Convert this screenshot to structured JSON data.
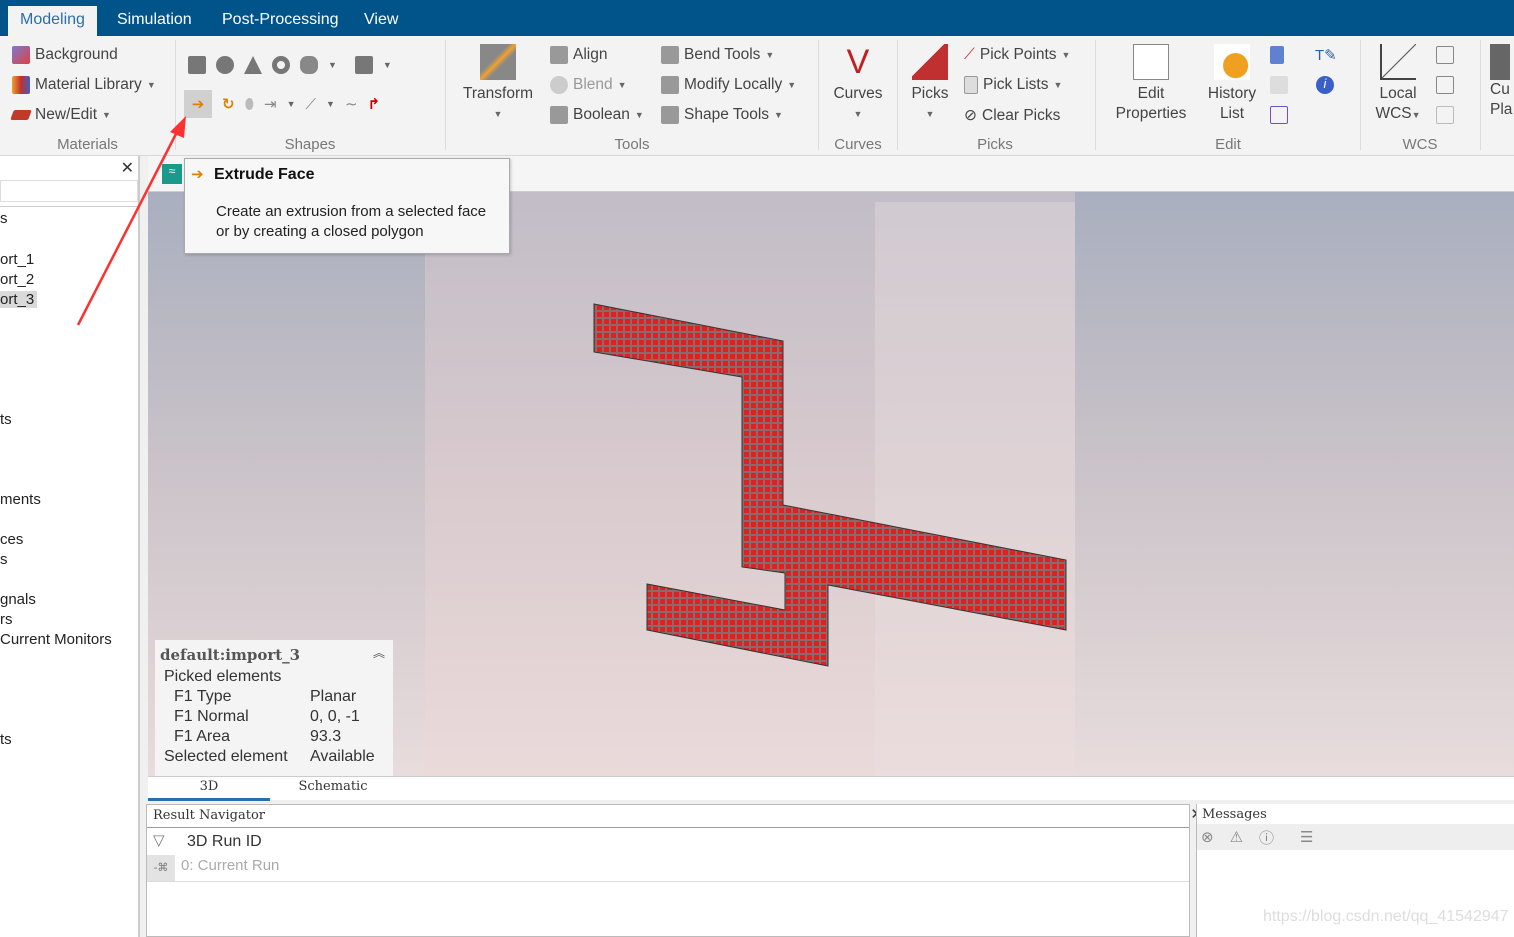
{
  "ribbon_tabs": [
    "Modeling",
    "Simulation",
    "Post-Processing",
    "View"
  ],
  "active_tab": "Modeling",
  "groups": {
    "materials": {
      "label": "Materials",
      "items": [
        "Background",
        "Material Library",
        "New/Edit"
      ]
    },
    "shapes": {
      "label": "Shapes"
    },
    "tools": {
      "label": "Tools",
      "transform": "Transform",
      "items": [
        "Align",
        "Blend",
        "Boolean",
        "Bend Tools",
        "Modify Locally",
        "Shape Tools"
      ]
    },
    "curves": {
      "label": "Curves",
      "button": "Curves"
    },
    "picks": {
      "label": "Picks",
      "button": "Picks",
      "items": [
        "Pick Points",
        "Pick Lists",
        "Clear Picks"
      ]
    },
    "edit": {
      "label": "Edit",
      "edit_properties_1": "Edit",
      "edit_properties_2": "Properties",
      "history_1": "History",
      "history_2": "List"
    },
    "wcs": {
      "label": "WCS",
      "local_1": "Local",
      "local_2": "WCS"
    },
    "cut": {
      "line1": "Cu",
      "line2": "Pla"
    }
  },
  "tooltip": {
    "title": "Extrude Face",
    "line1": "Create an extrusion from a selected face",
    "line2": "or by creating a closed polygon"
  },
  "tree": [
    "s",
    "ort_1",
    "ort_2",
    "ort_3",
    "ts",
    "ments",
    "ces",
    "s",
    "gnals",
    "rs",
    " Current Monitors",
    "ts"
  ],
  "selected_tree_item": "ort_3",
  "info": {
    "title": "default:import_3",
    "header": "Picked elements",
    "rows": [
      [
        "F1 Type",
        "Planar"
      ],
      [
        "F1 Normal",
        "0, 0, -1"
      ],
      [
        "F1 Area",
        "93.3"
      ]
    ],
    "selected_label": "Selected element",
    "selected_value": "Available"
  },
  "view_tabs": [
    "3D",
    "Schematic"
  ],
  "result_navigator": {
    "title": "Result Navigator",
    "column": "3D Run ID",
    "row": "0: Current Run"
  },
  "messages": {
    "title": "Messages"
  },
  "watermark": "https://blog.csdn.net/qq_41542947",
  "colors": {
    "tabbar": "#00548a",
    "shape": "#e02020",
    "annotation": "#ff3030"
  }
}
